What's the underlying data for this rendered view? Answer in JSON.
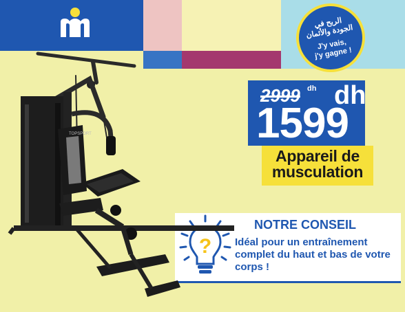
{
  "logo": {
    "icon": "marjane-logo-icon",
    "colors": {
      "yellow": "#f6e03a",
      "white": "#ffffff"
    }
  },
  "badge": {
    "arabic_line1": "الربح في",
    "arabic_line2": "الجودة والأثمان",
    "french_line1": "J'y vais,",
    "french_line2": "j'y gagne",
    "exclamation": "!"
  },
  "price": {
    "old_value": "2999",
    "old_currency": "dh",
    "currency": "dh",
    "new_value": "1599"
  },
  "product": {
    "name_line1": "Appareil de",
    "name_line2": "musculation",
    "icon": "home-gym-machine-icon"
  },
  "conseil": {
    "title": "NOTRE CONSEIL",
    "text": "Idéal pour un entraînement complet du haut et bas de votre corps !",
    "icon": "lightbulb-question-icon"
  },
  "colors": {
    "brand_blue": "#1f57b0",
    "yellow": "#f6e03a",
    "background": "#f1f0a8",
    "pink": "#eec4c2",
    "purple": "#a4386e",
    "light_blue": "#a9dde8"
  }
}
